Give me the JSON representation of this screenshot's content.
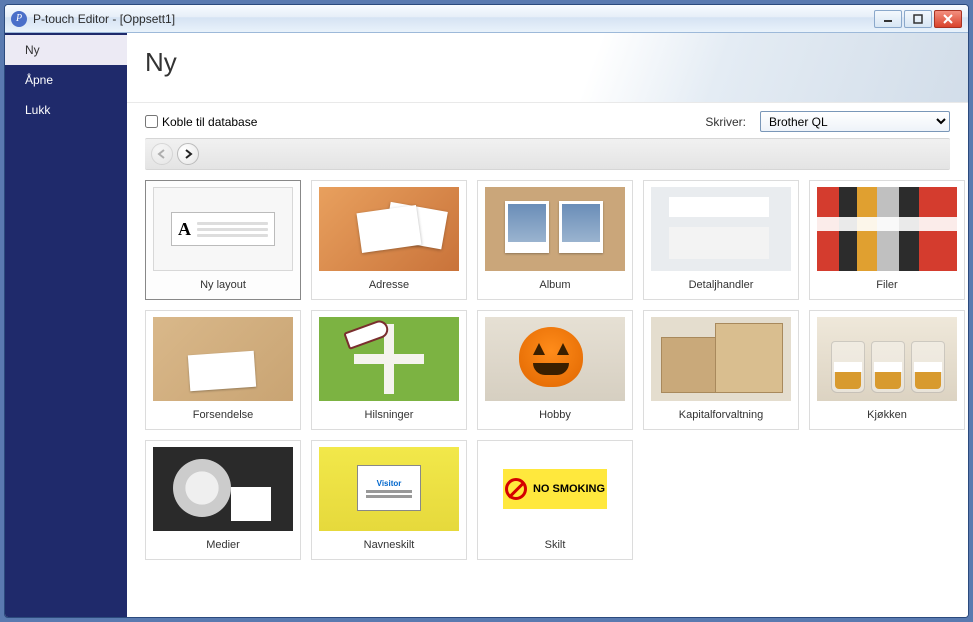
{
  "window": {
    "title": "P-touch Editor - [Oppsett1]"
  },
  "sidebar": {
    "items": [
      {
        "label": "Ny",
        "active": true
      },
      {
        "label": "Åpne",
        "active": false
      },
      {
        "label": "Lukk",
        "active": false
      }
    ]
  },
  "page": {
    "title": "Ny"
  },
  "options": {
    "connect_db_label": "Koble til database",
    "connect_db_checked": false,
    "printer_label": "Skriver:",
    "printer_selected": "Brother QL"
  },
  "templates": [
    {
      "id": "new-layout",
      "label": "Ny layout",
      "selected": true
    },
    {
      "id": "adresse",
      "label": "Adresse"
    },
    {
      "id": "album",
      "label": "Album"
    },
    {
      "id": "detalj",
      "label": "Detaljhandler"
    },
    {
      "id": "filer",
      "label": "Filer"
    },
    {
      "id": "forsendelse",
      "label": "Forsendelse"
    },
    {
      "id": "hilsninger",
      "label": "Hilsninger"
    },
    {
      "id": "hobby",
      "label": "Hobby"
    },
    {
      "id": "kapital",
      "label": "Kapitalforvaltning"
    },
    {
      "id": "kjokken",
      "label": "Kjøkken"
    },
    {
      "id": "medier",
      "label": "Medier"
    },
    {
      "id": "navneskilt",
      "label": "Navneskilt"
    },
    {
      "id": "skilt",
      "label": "Skilt",
      "sign_text": "NO SMOKING"
    }
  ],
  "navneskilt_badge": {
    "header": "Visitor"
  }
}
